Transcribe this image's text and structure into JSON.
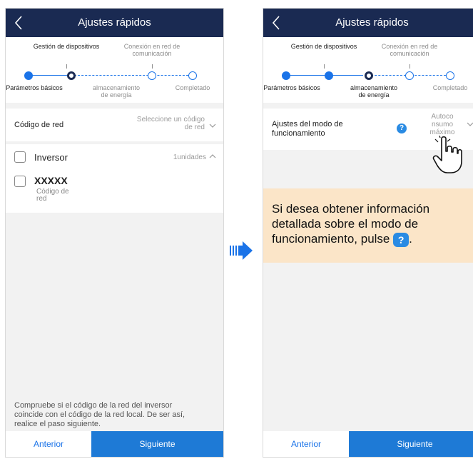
{
  "left": {
    "title": "Ajustes rápidos",
    "steps": {
      "top1": "Gestión de dispositivos",
      "top2_line1": "Conexión en red de",
      "top2_line2": "comunicación",
      "bottom1": "Parámetros básicos",
      "bottom2_line1": "almacenamiento",
      "bottom2_line2": "de energía",
      "bottom3": "Completado"
    },
    "grid_code_label": "Código de red",
    "grid_code_hint_line1": "Seleccione un código",
    "grid_code_hint_line2": "de red",
    "inverter_label": "Inversor",
    "inverter_units": "1unidades",
    "device_name": "XXXXX",
    "device_sub_line1": "Código de",
    "device_sub_line2": "red",
    "note_line1": "Compruebe si el código de la red del inversor",
    "note_line2": "coincide con el código de la red local. De ser así,",
    "note_line3": "realice el paso siguiente.",
    "btn_prev": "Anterior",
    "btn_next": "Siguiente"
  },
  "right": {
    "title": "Ajustes rápidos",
    "steps": {
      "top1": "Gestión de dispositivos",
      "top2_line1": "Conexión en red de",
      "top2_line2": "comunicación",
      "bottom1": "Parámetros básicos",
      "bottom2_line1": "almacenamiento",
      "bottom2_line2": "de energía",
      "bottom3": "Completado"
    },
    "mode_label_line1": "Ajustes del modo de",
    "mode_label_line2": "funcionamiento",
    "help_glyph": "?",
    "mode_value_line1": "Autoco",
    "mode_value_line2": "nsumo",
    "mode_value_line3": "máximo",
    "callout_line1": "Si desea obtener información",
    "callout_line2": "detallada sobre el modo de",
    "callout_line3_prefix": "funcionamiento, pulse",
    "callout_badge": "?",
    "callout_line3_suffix": ".",
    "btn_prev": "Anterior",
    "btn_next": "Siguiente"
  },
  "colors": {
    "header": "#1a2a52",
    "accent": "#1a73e8",
    "next_button": "#1e7ad6",
    "callout_bg": "#fbe5c8",
    "arrow": "#1a73e8"
  },
  "icons": [
    "back-chevron-icon",
    "chevron-down-icon",
    "chevron-up-icon",
    "help-icon",
    "pointing-hand-icon",
    "right-arrow-icon"
  ]
}
